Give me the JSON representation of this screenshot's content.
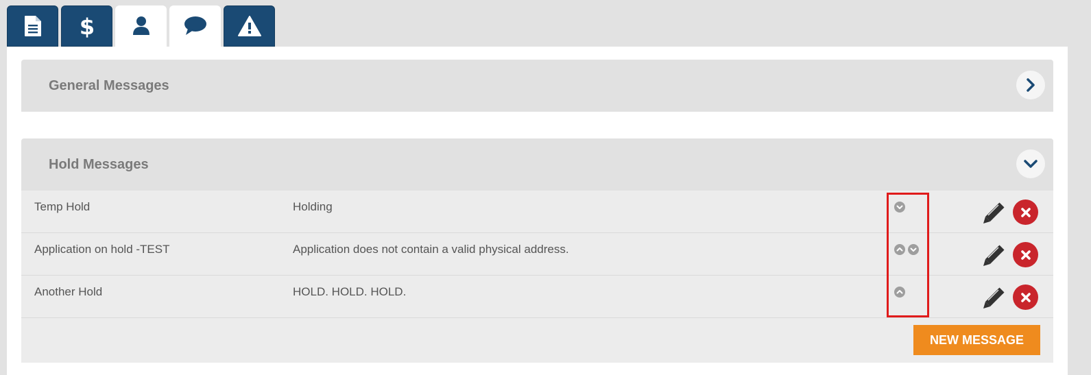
{
  "tabs": [
    {
      "icon": "document-icon",
      "state": "inactive"
    },
    {
      "icon": "dollar-icon",
      "state": "inactive"
    },
    {
      "icon": "user-icon",
      "state": "active"
    },
    {
      "icon": "chat-icon",
      "state": "active"
    },
    {
      "icon": "warning-icon",
      "state": "inactive"
    }
  ],
  "sections": {
    "general": {
      "title": "General Messages",
      "toggle_icon": "chevron-right-icon",
      "expanded": false
    },
    "hold": {
      "title": "Hold Messages",
      "toggle_icon": "chevron-down-icon",
      "expanded": true,
      "rows": [
        {
          "name": "Temp Hold",
          "message": "Holding",
          "order_icons": [
            "move-down-icon"
          ]
        },
        {
          "name": "Application on hold -TEST",
          "message": "Application does not contain a valid physical address.",
          "order_icons": [
            "move-up-icon",
            "move-down-icon"
          ]
        },
        {
          "name": "Another Hold",
          "message": "HOLD. HOLD. HOLD.",
          "order_icons": [
            "move-up-icon"
          ]
        }
      ],
      "new_message_label": "NEW MESSAGE"
    }
  },
  "colors": {
    "tab_dark": "#1a4a74",
    "accent_orange": "#ef8b1e",
    "delete_red": "#c9252c",
    "highlight_red": "#e01b1b"
  }
}
